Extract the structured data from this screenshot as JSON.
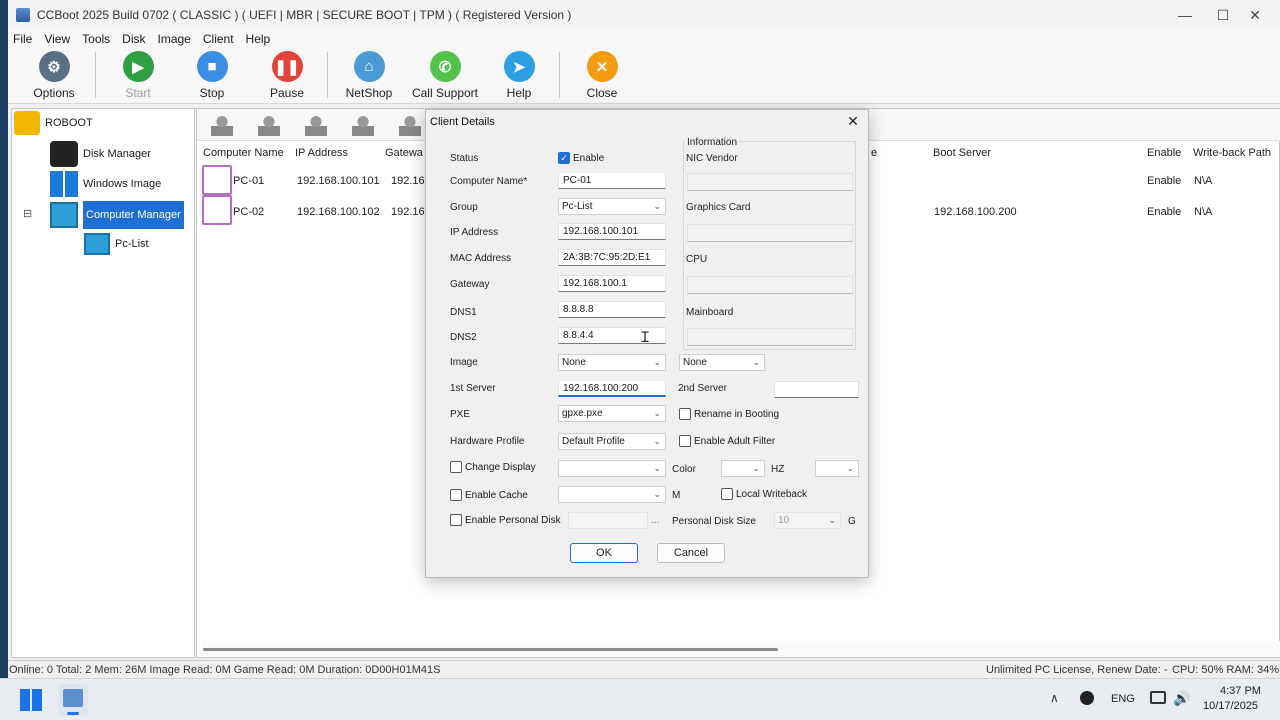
{
  "app": {
    "title": "CCBoot 2025 Build 0702 ( CLASSIC ) ( UEFI | MBR | SECURE BOOT | TPM ) ( Registered Version )",
    "minimize": "—",
    "maximize": "☐",
    "close": "✕"
  },
  "menu": [
    "File",
    "View",
    "Tools",
    "Disk",
    "Image",
    "Client",
    "Help"
  ],
  "toolbar": {
    "options": "Options",
    "start": "Start",
    "stop": "Stop",
    "pause": "Pause",
    "netshop": "NetShop",
    "call_support": "Call Support",
    "help": "Help",
    "close": "Close"
  },
  "tree": {
    "root": "ROBOOT",
    "disk_manager": "Disk Manager",
    "windows_image": "Windows Image",
    "computer_manager": "Computer Manager",
    "expander": "⊟",
    "pc_list": "Pc-List"
  },
  "table": {
    "columns": {
      "computer_name": "Computer Name",
      "ip_address": "IP Address",
      "gateway": "Gatewa",
      "partial": "e",
      "boot_server": "Boot Server",
      "enable": "Enable",
      "writeback_path": "Write-back Path"
    },
    "rows": [
      {
        "name": "PC-01",
        "ip": "192.168.100.101",
        "gateway": "192.168",
        "boot_server": "",
        "enable": "Enable",
        "writeback": "N\\A"
      },
      {
        "name": "PC-02",
        "ip": "192.168.100.102",
        "gateway": "192.168",
        "boot_server": "192.168.100.200",
        "enable": "Enable",
        "writeback": "N\\A"
      }
    ]
  },
  "dialog": {
    "title": "Client Details",
    "close": "✕",
    "labels": {
      "status": "Status",
      "computer_name": "Computer Name*",
      "group": "Group",
      "ip_address": "IP Address",
      "mac_address": "MAC Address",
      "gateway": "Gateway",
      "dns1": "DNS1",
      "dns2": "DNS2",
      "image": "Image",
      "first_server": "1st Server",
      "second_server": "2nd Server",
      "pxe": "PXE",
      "hardware_profile": "Hardware Profile",
      "color": "Color",
      "hz": "HZ",
      "m": "M",
      "personal_disk_size": "Personal Disk Size",
      "g": "G"
    },
    "values": {
      "enable": "Enable",
      "computer_name": "PC-01",
      "group": "Pc-List",
      "ip_address": "192.168.100.101",
      "mac_address": "2A:3B:7C:95:2D:E1",
      "gateway": "192.168.100.1",
      "dns1": "8.8.8.8",
      "dns2": "8.8.4.4",
      "image": "None",
      "image2": "None",
      "first_server": "192.168.100.200",
      "second_server": "",
      "pxe": "gpxe.pxe",
      "hardware_profile": "Default Profile",
      "change_display_value": "",
      "color_value": "",
      "hz_value": "",
      "cache_value": "",
      "personal_disk_path": "",
      "personal_disk_browse": "...",
      "personal_disk_size": "10"
    },
    "checkboxes": {
      "rename_in_booting": "Rename in Booting",
      "enable_adult_filter": "Enable Adult Filter",
      "change_display": "Change Display",
      "enable_cache": "Enable Cache",
      "local_writeback": "Local Writeback",
      "enable_personal_disk": "Enable Personal Disk"
    },
    "information": {
      "heading": "Information",
      "nic_vendor": "NIC Vendor",
      "graphics_card": "Graphics Card",
      "cpu": "CPU",
      "mainboard": "Mainboard"
    },
    "ok": "OK",
    "cancel": "Cancel"
  },
  "statusbar": {
    "left": "Online: 0 Total: 2 Mem: 26M Image Read: 0M Game Read: 0M Duration: 0D00H01M41S",
    "license": "Unlimited PC License, Renew Date: -",
    "usage": "CPU: 50% RAM: 34%"
  },
  "taskbar": {
    "lang": "ENG",
    "time": "4:37 PM",
    "date": "10/17/2025",
    "chevron": "∧"
  },
  "colors": {
    "accent": "#1e6fd4",
    "start_green": "#2ea043",
    "stop_blue": "#3a8ee6",
    "pause_red": "#e04438",
    "netshop_blue": "#4a9ad8",
    "support_green": "#54c24a",
    "help_blue": "#2d9fe0",
    "close_orange": "#f39c12"
  }
}
